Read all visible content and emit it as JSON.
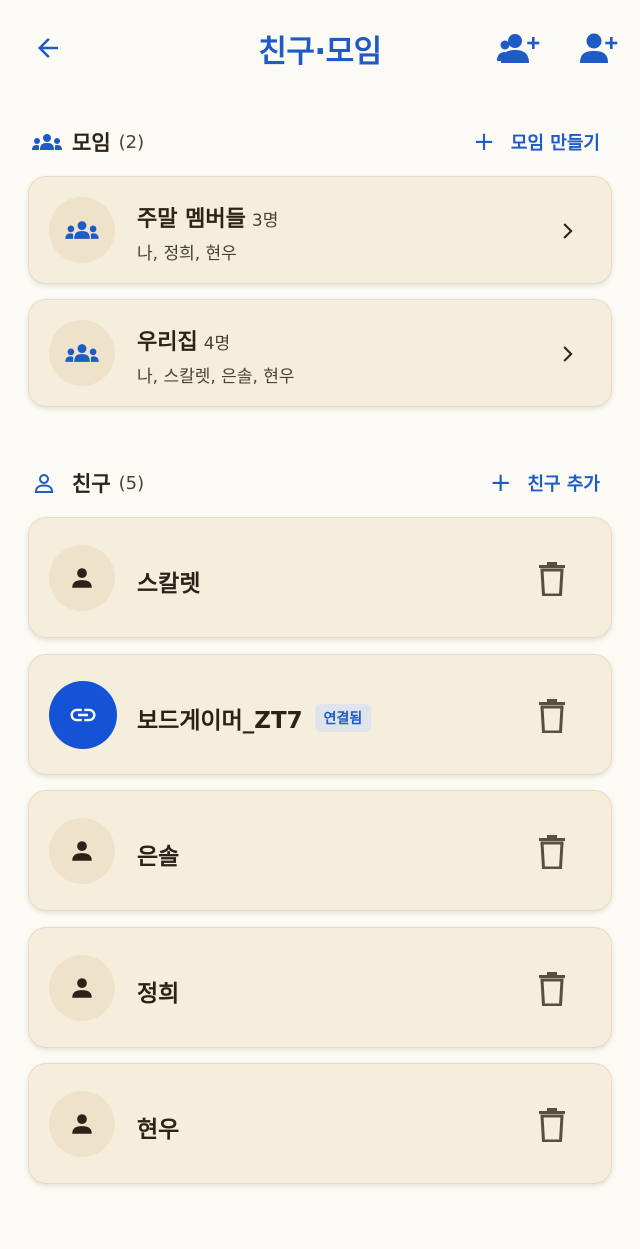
{
  "header": {
    "title": "친구·모임"
  },
  "groups_section": {
    "title": "모임",
    "count": "(2)",
    "action_label": "모임 만들기",
    "items": [
      {
        "name": "주말 멤버들",
        "count": "3명",
        "members": "나, 정희, 현우"
      },
      {
        "name": "우리집",
        "count": "4명",
        "members": "나, 스칼렛, 은솔, 현우"
      }
    ]
  },
  "friends_section": {
    "title": "친구",
    "count": "(5)",
    "action_label": "친구 추가",
    "items": [
      {
        "name": "스칼렛",
        "badge": ""
      },
      {
        "name": "보드게이머_ZT7",
        "badge": "연결됨"
      },
      {
        "name": "은솔",
        "badge": ""
      },
      {
        "name": "정희",
        "badge": ""
      },
      {
        "name": "현우",
        "badge": ""
      }
    ]
  },
  "colors": {
    "accent": "#1e5bc6",
    "card_bg": "#f6eedc",
    "page_bg": "#fcfaf4",
    "linked_avatar": "#1452d6"
  },
  "icons": {
    "back": "arrow-left-icon",
    "header_right_1": "group-add-icon",
    "header_right_2": "person-add-icon",
    "group": "groups-icon",
    "friend": "person-icon",
    "linked": "link-icon",
    "delete": "trash-icon",
    "chevron": "chevron-right-icon"
  }
}
